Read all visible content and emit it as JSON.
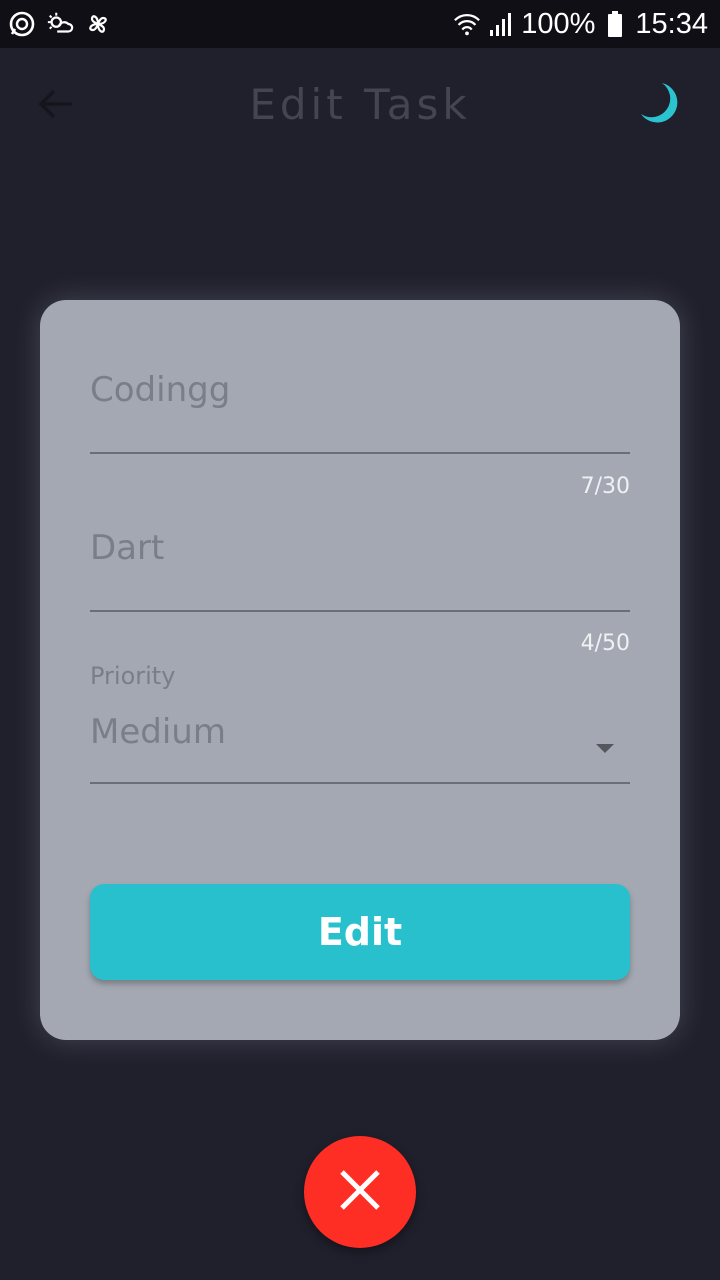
{
  "status_bar": {
    "battery_percent": "100%",
    "time": "15:34",
    "icons": [
      "whatsapp-icon",
      "weather-icon",
      "pinwheel-icon",
      "wifi-icon",
      "signal-icon",
      "battery-icon"
    ]
  },
  "app_bar": {
    "title": "Edit Task",
    "back_icon": "arrow-back-icon",
    "theme_icon": "moon-icon"
  },
  "form": {
    "task_name": {
      "value": "Codingg",
      "counter": "7/30"
    },
    "description": {
      "value": "Dart",
      "counter": "4/50"
    },
    "priority": {
      "label": "Priority",
      "value": "Medium"
    },
    "submit_label": "Edit"
  },
  "fab": {
    "icon": "close-icon"
  },
  "colors": {
    "background": "#20202d",
    "card": "#a4a8b2",
    "accent": "#28c0cc",
    "danger": "#ff2e24"
  }
}
